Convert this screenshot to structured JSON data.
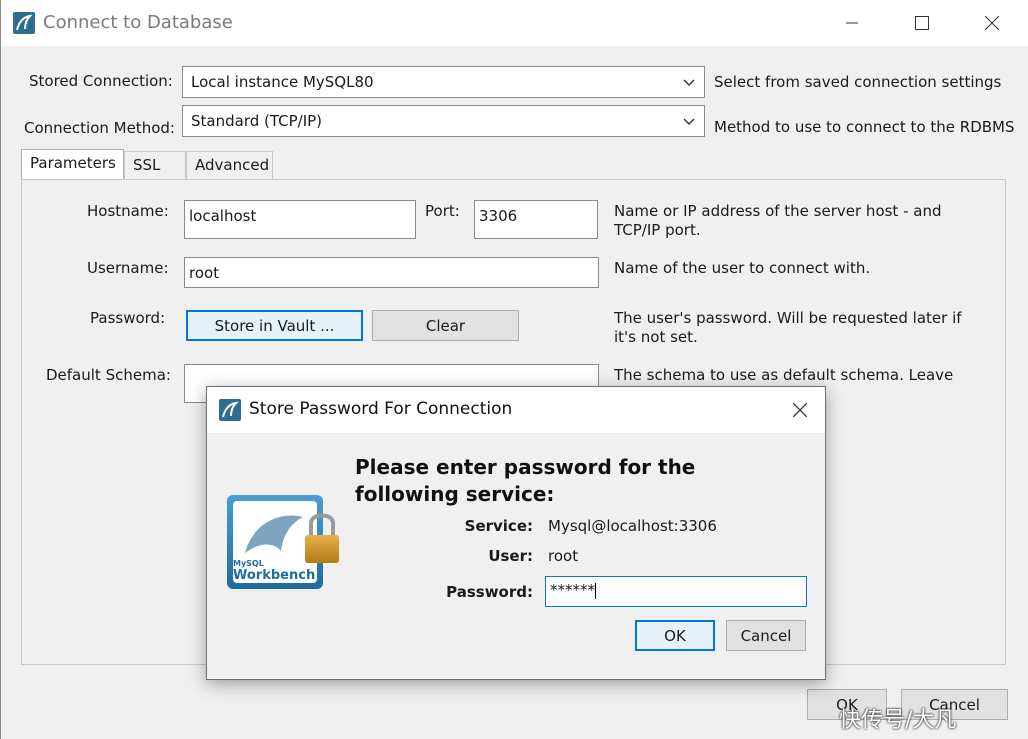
{
  "window": {
    "title": "Connect to Database",
    "minimize_icon": "minimize-icon",
    "maximize_icon": "maximize-icon",
    "close_icon": "close-icon"
  },
  "stored_connection": {
    "label": "Stored Connection:",
    "value": "Local instance MySQL80",
    "help": "Select from saved connection settings"
  },
  "connection_method": {
    "label": "Connection Method:",
    "value": "Standard (TCP/IP)",
    "help": "Method to use to connect to the RDBMS"
  },
  "tabs": [
    {
      "label": "Parameters",
      "active": true
    },
    {
      "label": "SSL",
      "active": false
    },
    {
      "label": "Advanced",
      "active": false
    }
  ],
  "params": {
    "hostname_label": "Hostname:",
    "hostname_value": "localhost",
    "port_label": "Port:",
    "port_value": "3306",
    "hostname_help": "Name or IP address of the server host - and TCP/IP port.",
    "username_label": "Username:",
    "username_value": "root",
    "username_help": "Name of the user to connect with.",
    "password_label": "Password:",
    "store_vault_label": "Store in Vault ...",
    "clear_label": "Clear",
    "password_help": "The user's password. Will be requested later if it's not set.",
    "schema_label": "Default Schema:",
    "schema_value": "",
    "schema_help": "The schema to use as default schema. Leave"
  },
  "footer": {
    "ok_label": "OK",
    "cancel_label": "Cancel"
  },
  "dialog": {
    "title": "Store Password For Connection",
    "heading": "Please enter password for the following service:",
    "service_label": "Service:",
    "service_value": "Mysql@localhost:3306",
    "user_label": "User:",
    "user_value": "root",
    "password_label": "Password:",
    "password_value": "******",
    "ok_label": "OK",
    "cancel_label": "Cancel",
    "logo_text": "Workbench",
    "logo_small": "MySQL"
  },
  "watermark": "快传号/大凡",
  "accent": "#0078d7"
}
